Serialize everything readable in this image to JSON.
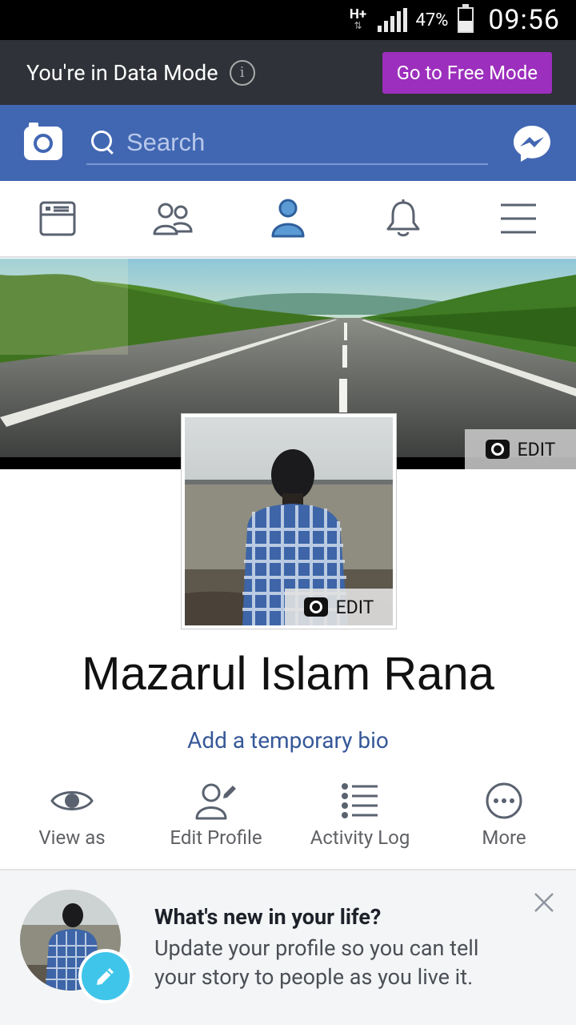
{
  "status_bar": {
    "network": "H+",
    "battery": "47%",
    "time": "09:56",
    "battery_fraction": 0.47
  },
  "data_mode": {
    "text": "You're in Data Mode",
    "info_glyph": "i",
    "button": "Go to Free Mode",
    "button_color": "#9c2fbd"
  },
  "header": {
    "search_placeholder": "Search",
    "brand_color": "#4267b2"
  },
  "nav": {
    "items": [
      "news-feed-icon",
      "friends-icon",
      "profile-icon",
      "notifications-icon",
      "menu-icon"
    ],
    "active": "profile-icon",
    "active_color": "#4267b2"
  },
  "profile": {
    "cover_edit": "EDIT",
    "picture_edit": "EDIT",
    "name": "Mazarul Islam Rana",
    "bio_link": "Add a temporary bio"
  },
  "actions": [
    {
      "label": "View as",
      "icon": "eye-icon"
    },
    {
      "label": "Edit Profile",
      "icon": "edit-profile-icon"
    },
    {
      "label": "Activity Log",
      "icon": "list-icon"
    },
    {
      "label": "More",
      "icon": "more-icon"
    }
  ],
  "prompt": {
    "title": "What's new in your life?",
    "text": "Update your profile so you can tell your story to people as you live it."
  }
}
